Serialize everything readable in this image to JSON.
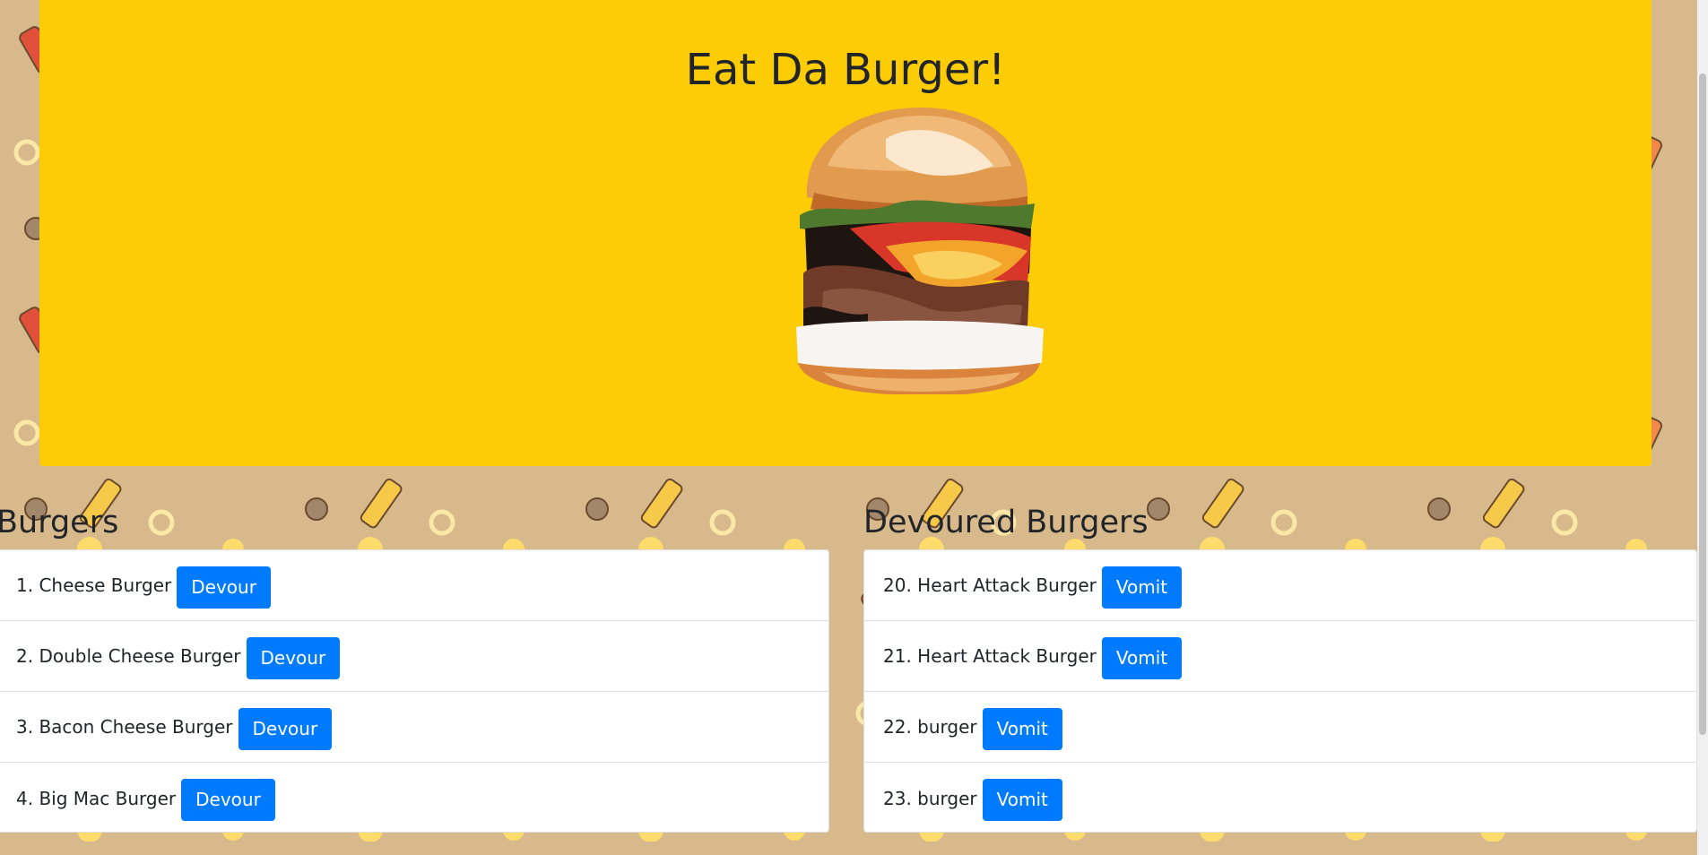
{
  "header": {
    "title": "Eat Da Burger!",
    "image_alt": "burger"
  },
  "burgers_section": {
    "heading": "Burgers",
    "items": [
      {
        "label": "1. Cheese Burger",
        "button": "Devour"
      },
      {
        "label": "2. Double Cheese Burger",
        "button": "Devour"
      },
      {
        "label": "3. Bacon Cheese Burger",
        "button": "Devour"
      },
      {
        "label": "4. Big Mac Burger",
        "button": "Devour"
      }
    ]
  },
  "devoured_section": {
    "heading": "Devoured Burgers",
    "items": [
      {
        "label": "20. Heart Attack Burger",
        "button": "Vomit"
      },
      {
        "label": "21. Heart Attack Burger",
        "button": "Vomit"
      },
      {
        "label": "22. burger",
        "button": "Vomit"
      },
      {
        "label": "23. burger",
        "button": "Vomit"
      }
    ]
  },
  "colors": {
    "jumbotron": "#fccc06",
    "background": "#d8b98b",
    "button": "#007bff"
  }
}
